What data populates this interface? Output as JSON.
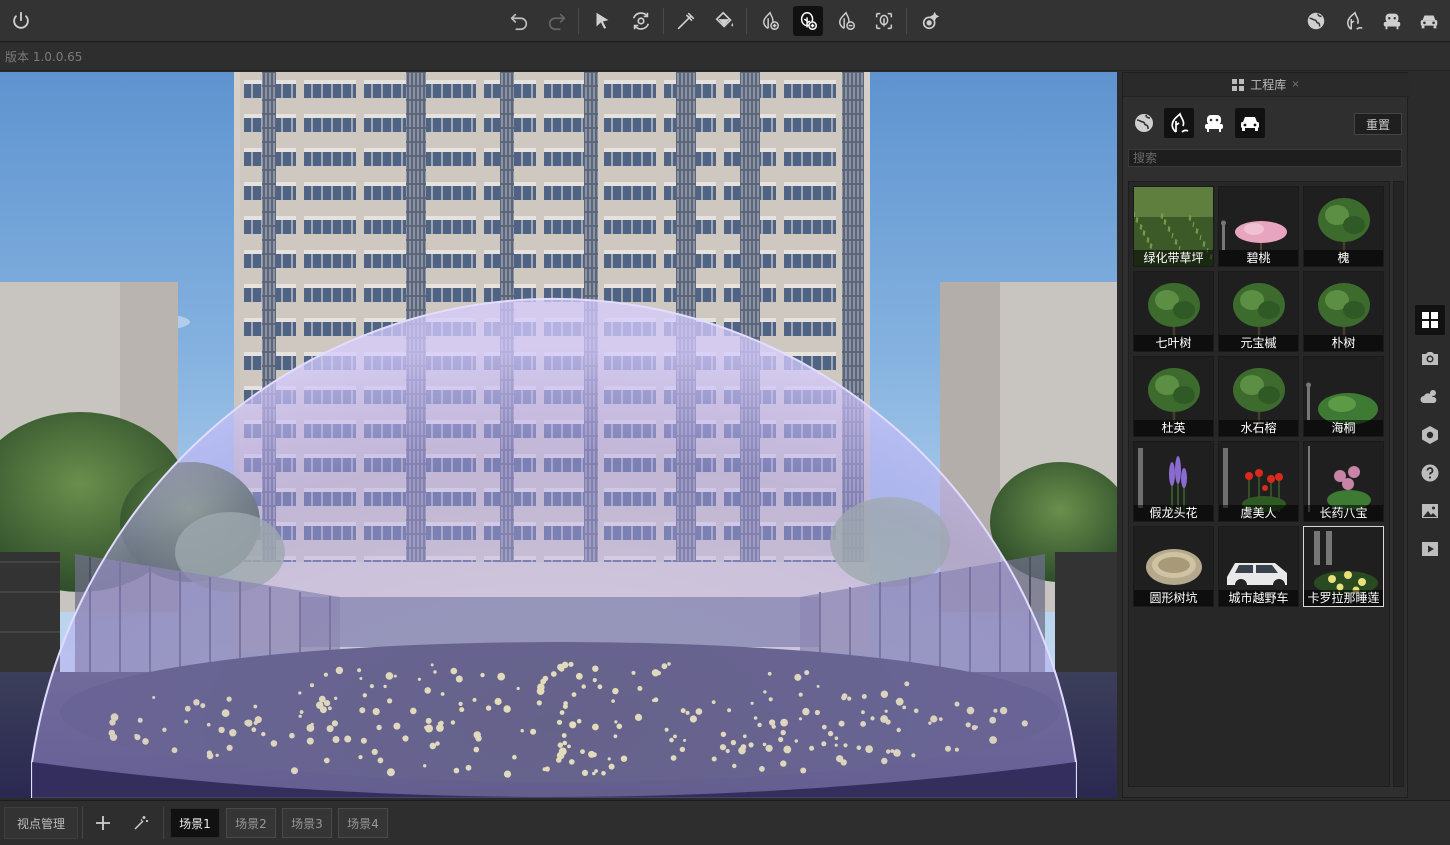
{
  "version": "版本 1.0.0.65",
  "toolbar": {
    "left": [
      {
        "icon": "power-icon"
      }
    ],
    "center": [
      {
        "icon": "undo-icon"
      },
      {
        "icon": "redo-icon"
      },
      {
        "icon": "select-arrow-icon"
      },
      {
        "icon": "orbit-icon"
      },
      {
        "icon": "eyedropper-icon"
      },
      {
        "icon": "paint-bucket-icon"
      },
      {
        "icon": "plant-add-icon"
      },
      {
        "icon": "plant-brush-icon",
        "active": true
      },
      {
        "icon": "plant-remove-icon"
      },
      {
        "icon": "plant-scatter-icon"
      },
      {
        "icon": "effect-settings-icon"
      }
    ],
    "right": [
      {
        "icon": "globe-icon"
      },
      {
        "icon": "plant-icon"
      },
      {
        "icon": "furniture-icon"
      },
      {
        "icon": "car-icon"
      }
    ]
  },
  "library": {
    "title": "工程库",
    "close": "×",
    "reset_label": "重置",
    "search_placeholder": "搜索",
    "categories": [
      {
        "icon": "globe-icon",
        "active": false
      },
      {
        "icon": "plant-icon",
        "active": true
      },
      {
        "icon": "furniture-icon",
        "active": false
      },
      {
        "icon": "car-icon",
        "active": false
      }
    ],
    "items": [
      {
        "label": "绿化带草坪",
        "thumb": "grass"
      },
      {
        "label": "碧桃",
        "thumb": "blossom"
      },
      {
        "label": "槐",
        "thumb": "tree"
      },
      {
        "label": "七叶树",
        "thumb": "tree"
      },
      {
        "label": "元宝槭",
        "thumb": "tree"
      },
      {
        "label": "朴树",
        "thumb": "tree"
      },
      {
        "label": "杜英",
        "thumb": "tree"
      },
      {
        "label": "水石榕",
        "thumb": "tree"
      },
      {
        "label": "海桐",
        "thumb": "shrub"
      },
      {
        "label": "假龙头花",
        "thumb": "flower-purple"
      },
      {
        "label": "虞美人",
        "thumb": "flower-red"
      },
      {
        "label": "长药八宝",
        "thumb": "flower-pink"
      },
      {
        "label": "圆形树坑",
        "thumb": "pit"
      },
      {
        "label": "城市越野车",
        "thumb": "suv"
      },
      {
        "label": "卡罗拉那睡莲",
        "thumb": "lily",
        "selected": true
      }
    ]
  },
  "side_tools": [
    {
      "icon": "grid-icon",
      "active": true
    },
    {
      "icon": "camera-icon"
    },
    {
      "icon": "weather-icon"
    },
    {
      "icon": "settings-icon"
    },
    {
      "icon": "help-icon"
    },
    {
      "icon": "image-icon"
    },
    {
      "icon": "play-icon"
    }
  ],
  "bottom": {
    "viewpoint_label": "视点管理",
    "scenes": [
      {
        "label": "场景1",
        "active": true
      },
      {
        "label": "场景2"
      },
      {
        "label": "场景3"
      },
      {
        "label": "场景4"
      }
    ]
  },
  "colors": {
    "bg": "#2b2b2b",
    "active": "#111111",
    "dome": "#b7a8f0"
  }
}
